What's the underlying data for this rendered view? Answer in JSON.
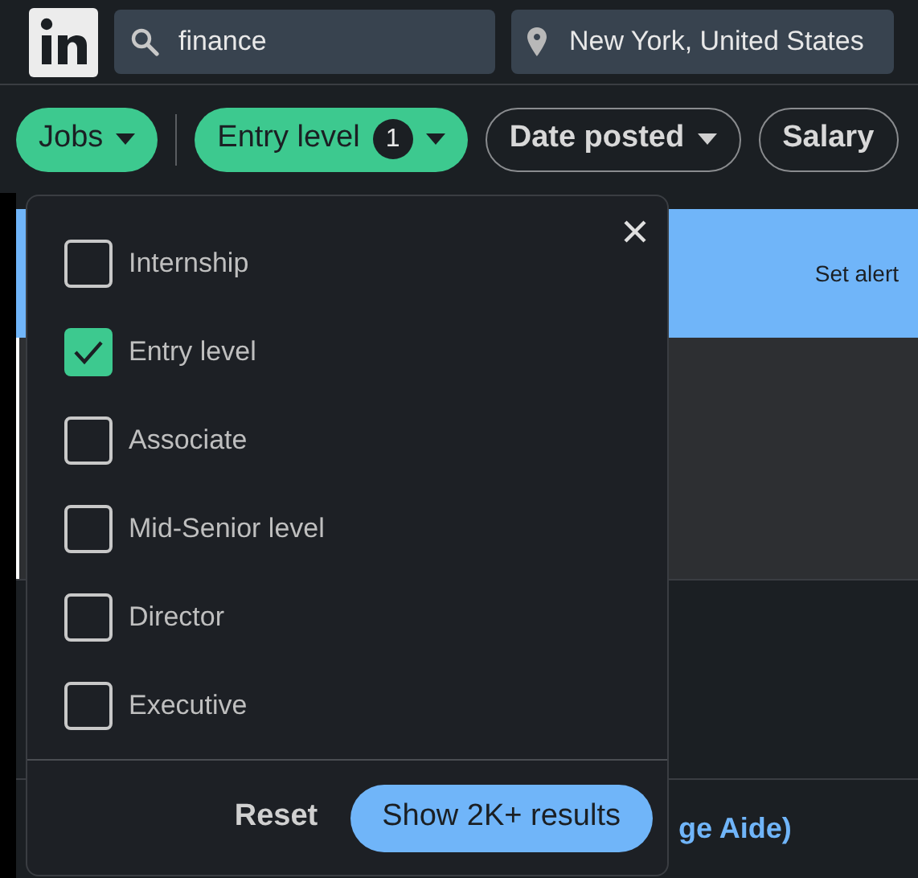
{
  "header": {
    "search": {
      "value": "finance"
    },
    "location": {
      "value": "New York, United States"
    }
  },
  "filters": [
    {
      "label": "Jobs",
      "selected": true
    },
    {
      "label": "Entry level",
      "selected": true,
      "count": "1"
    },
    {
      "label": "Date posted",
      "selected": false
    },
    {
      "label": "Salary",
      "selected": false
    }
  ],
  "banner": {
    "action": "Set alert"
  },
  "link_fragment": "ge Aide)",
  "popup": {
    "options": [
      {
        "label": "Internship",
        "checked": false
      },
      {
        "label": "Entry level",
        "checked": true
      },
      {
        "label": "Associate",
        "checked": false
      },
      {
        "label": "Mid-Senior level",
        "checked": false
      },
      {
        "label": "Director",
        "checked": false
      },
      {
        "label": "Executive",
        "checked": false
      }
    ],
    "reset": "Reset",
    "apply": "Show 2K+ results"
  }
}
